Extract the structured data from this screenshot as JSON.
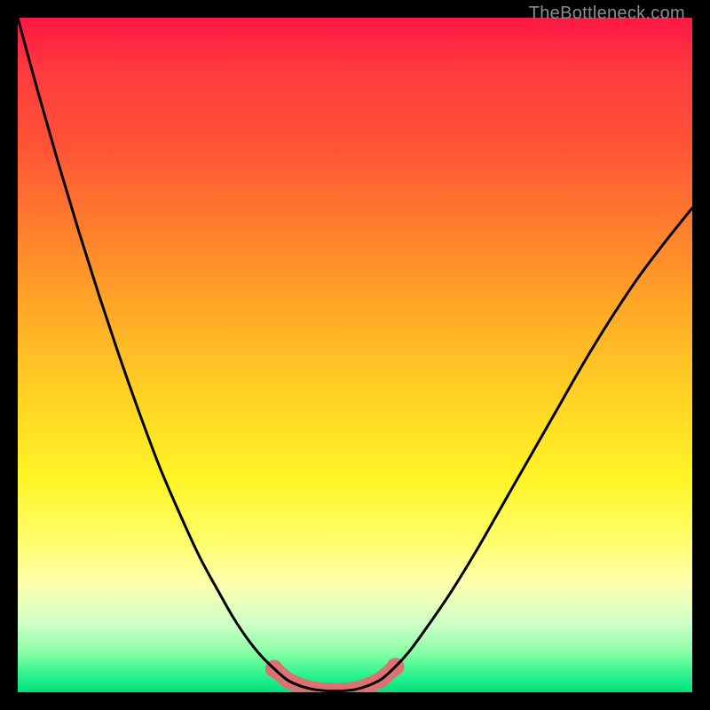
{
  "watermark": "TheBottleneck.com",
  "colors": {
    "marker": "#e06f72",
    "curve": "#000000",
    "frame": "#000000"
  },
  "chart_data": {
    "type": "line",
    "title": "",
    "xlabel": "",
    "ylabel": "",
    "xlim": [
      0,
      1
    ],
    "ylim": [
      0,
      1
    ],
    "grid": false,
    "annotations": [
      "TheBottleneck.com"
    ],
    "series": [
      {
        "name": "bottleneck-curve",
        "x": [
          0.0,
          0.03,
          0.06,
          0.09,
          0.12,
          0.15,
          0.18,
          0.21,
          0.24,
          0.27,
          0.3,
          0.32,
          0.34,
          0.36,
          0.38,
          0.4,
          0.42,
          0.44,
          0.46,
          0.48,
          0.5,
          0.52,
          0.54,
          0.56,
          0.58,
          0.6,
          0.64,
          0.68,
          0.72,
          0.76,
          0.8,
          0.84,
          0.88,
          0.92,
          0.96,
          1.0
        ],
        "y": [
          1.0,
          0.89,
          0.785,
          0.685,
          0.59,
          0.5,
          0.415,
          0.335,
          0.265,
          0.2,
          0.145,
          0.11,
          0.08,
          0.055,
          0.035,
          0.018,
          0.009,
          0.004,
          0.002,
          0.002,
          0.004,
          0.01,
          0.02,
          0.038,
          0.06,
          0.087,
          0.145,
          0.21,
          0.28,
          0.35,
          0.42,
          0.49,
          0.555,
          0.615,
          0.668,
          0.718
        ]
      }
    ],
    "markers": {
      "name": "optimal-range",
      "color": "#e06f72",
      "x": [
        0.38,
        0.4,
        0.42,
        0.44,
        0.46,
        0.48,
        0.5,
        0.52,
        0.54,
        0.56
      ],
      "y": [
        0.035,
        0.018,
        0.009,
        0.004,
        0.002,
        0.002,
        0.004,
        0.01,
        0.02,
        0.038
      ]
    }
  }
}
